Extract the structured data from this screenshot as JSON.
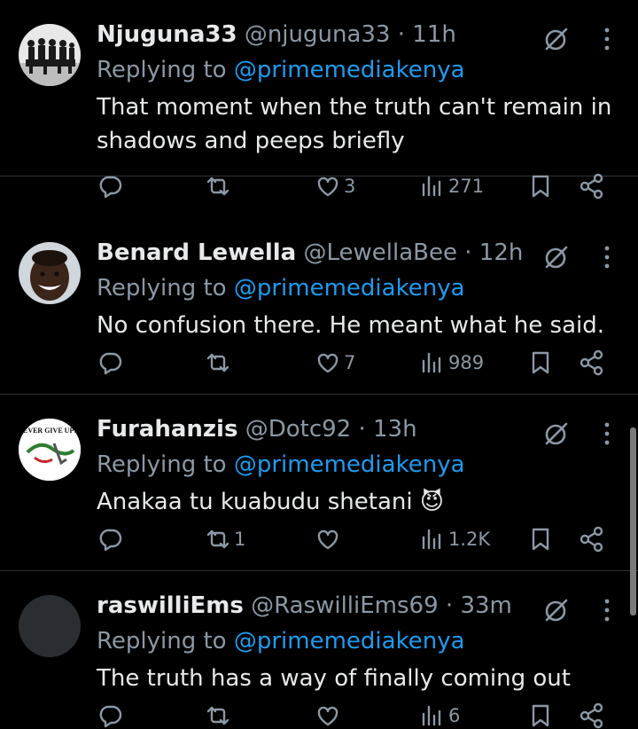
{
  "colors": {
    "background": "#000000",
    "text": "#e7e9ea",
    "secondary": "#8b98a5",
    "accent": "#1d9bf0",
    "divider": "#2f3336"
  },
  "tweets": [
    {
      "name": "Njuguna33",
      "handle": "@njuguna33",
      "dot": "·",
      "time": "11h",
      "replying_prefix": "Replying to",
      "replying_to": "@primemediakenya",
      "text": "That moment when the truth can't remain in shadows and peeps briefly",
      "replies": "",
      "retweets": "",
      "likes": "3",
      "views": "271",
      "avatar": "group-photo-avatar"
    },
    {
      "name": "Benard Lewella",
      "handle": "@LewellaBee",
      "dot": "·",
      "time": "12h",
      "replying_prefix": "Replying to",
      "replying_to": "@primemediakenya",
      "text": "No confusion there. He meant what he said.",
      "replies": "",
      "retweets": "",
      "likes": "7",
      "views": "989",
      "avatar": "smiling-man-avatar"
    },
    {
      "name": "Furahanzis",
      "handle": "@Dotc92",
      "dot": "·",
      "time": "13h",
      "replying_prefix": "Replying to",
      "replying_to": "@primemediakenya",
      "text": "Anakaa tu kuabudu shetani 😈",
      "replies": "",
      "retweets": "1",
      "likes": "",
      "views": "1.2K",
      "avatar": "never-give-up-avatar",
      "avatar_text": "EVER GIVE UP!"
    },
    {
      "name": "raswilliEms",
      "handle": "@RaswilliEms69",
      "dot": "·",
      "time": "33m",
      "replying_prefix": "Replying to",
      "replying_to": "@primemediakenya",
      "text": "The truth has a way of finally coming out",
      "replies": "",
      "retweets": "",
      "likes": "",
      "views": "6",
      "avatar": "default-avatar"
    }
  ],
  "icons": {
    "reply": "reply-icon",
    "retweet": "retweet-icon",
    "like": "heart-icon",
    "views": "views-icon",
    "bookmark": "bookmark-icon",
    "share": "share-icon",
    "grok": "grok-icon",
    "more": "more-icon"
  }
}
